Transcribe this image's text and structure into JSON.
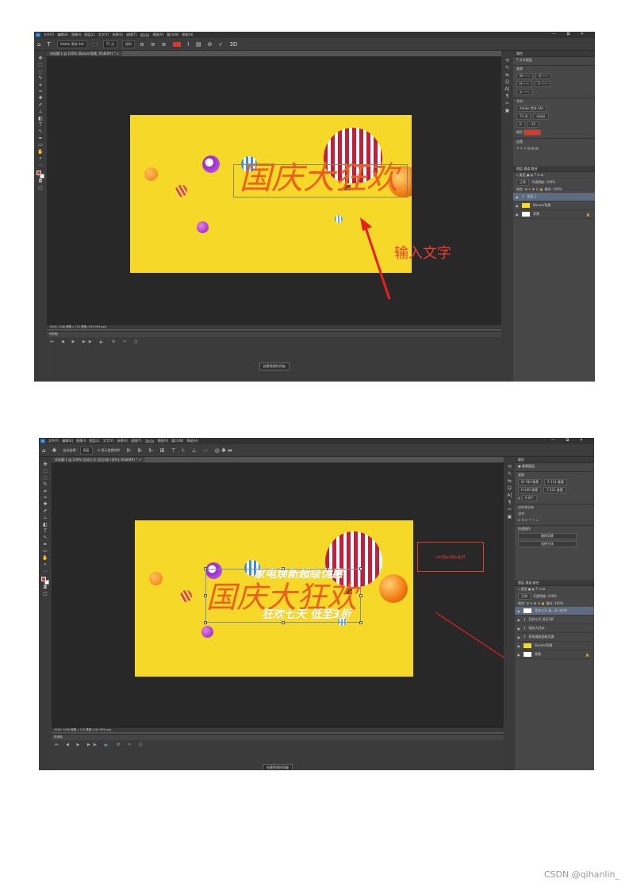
{
  "screen1": {
    "app_badge": "Ps",
    "menu": [
      "文件(F)",
      "编辑(E)",
      "图像(I)",
      "图层(L)",
      "文字(Y)",
      "选择(S)",
      "滤镜(T)",
      "3D(D)",
      "视图(V)",
      "窗口(W)",
      "帮助(H)"
    ],
    "window_controls": "— ⧉ ✕",
    "options": {
      "font_family": "Adobe 黑体 Std",
      "font_size": "72 点",
      "anti_alias": "锐利",
      "text_color": "#d53a2b"
    },
    "tab": "未标题-1 @ 100% (Banner背景, RGB/8#) * ×",
    "banner_title": "国庆大狂欢",
    "annotation": "输入文字",
    "status": "100%   1280 像素 x 720 像素 (143.993 ppi)",
    "timeline_label": "时间轴",
    "timeline_button": "创建视频时间轴",
    "panel": {
      "properties_header": "属性",
      "text_layer": "文字图层",
      "transform": "变换",
      "character": "字符",
      "font": "Adobe 黑体 Std",
      "size": "72 点",
      "leading": "(自动)",
      "tracking": "0",
      "kerning": "-25",
      "color_label": "颜色",
      "color": "#d53a2b",
      "paragraph": "段落",
      "layers_tabs": "图层  通道  路径",
      "blend": "正常",
      "opacity": "不透明度: 100%",
      "fill": "填充: 100%",
      "lock": "锁定:",
      "layers": [
        {
          "name": "图层 1",
          "kind": "text",
          "selected": true
        },
        {
          "name": "Banner背景",
          "kind": "group",
          "selected": false
        },
        {
          "name": "背景",
          "kind": "white",
          "selected": false
        }
      ]
    }
  },
  "screen2": {
    "app_badge": "Ps",
    "menu": [
      "文件(F)",
      "编辑(E)",
      "图像(I)",
      "图层(L)",
      "文字(Y)",
      "选择(S)",
      "滤镜(T)",
      "3D(D)",
      "视图(V)",
      "窗口(W)",
      "帮助(H)"
    ],
    "window_controls": "— ⧉ ✕",
    "options": {
      "auto_select": "自动选择:",
      "target": "图层",
      "show_transform": "显示变换控件"
    },
    "tab": "未标题-1 @ 100% (狂欢七天 低至3折 (合并), RGB/8#) * ×",
    "banner_sub_top": "家电焕新超级优惠",
    "banner_title": "国庆大狂欢",
    "banner_sub_bottom": "狂欢七天 低至3折",
    "annotation": "ctrl加alt加e合并",
    "status": "100%   1280 像素 x 720 像素 (143.993 ppi)",
    "timeline_label": "时间轴",
    "timeline_button": "创建视频时间轴",
    "panel": {
      "properties_header": "属性",
      "pixel_layer": "像素图层",
      "transform": "变换",
      "w": "W 780 像素",
      "x": "X 111 像素",
      "h": "H 240 像素",
      "y": "Y 221 像素",
      "angle": "0.00°",
      "align": "对齐并分布",
      "align_to": "对齐:",
      "quick": "快速操作",
      "remove_bg": "删除背景",
      "select_subject": "选择主体",
      "layers_tabs": "图层  通道  路径",
      "blend": "正常",
      "opacity": "不透明度: 100%",
      "fill": "填充: 100%",
      "lock": "锁定:",
      "layers": [
        {
          "name": "狂欢七天 低...折 (合并)",
          "kind": "white",
          "selected": true
        },
        {
          "name": "狂欢七天 低至3折",
          "kind": "text",
          "selected": false
        },
        {
          "name": "国庆大狂欢",
          "kind": "text",
          "selected": false
        },
        {
          "name": "家电焕新超级优惠",
          "kind": "text",
          "selected": false
        },
        {
          "name": "Banner背景",
          "kind": "group",
          "selected": false
        },
        {
          "name": "背景",
          "kind": "white",
          "selected": false
        }
      ]
    }
  },
  "watermark": "CSDN @qihanlin_",
  "colors": {
    "banner": "#f6d829",
    "title": "#ee5e1f",
    "annotation": "#ef3d2f",
    "ps_bg": "#535353",
    "canvas_bg": "#282828"
  }
}
